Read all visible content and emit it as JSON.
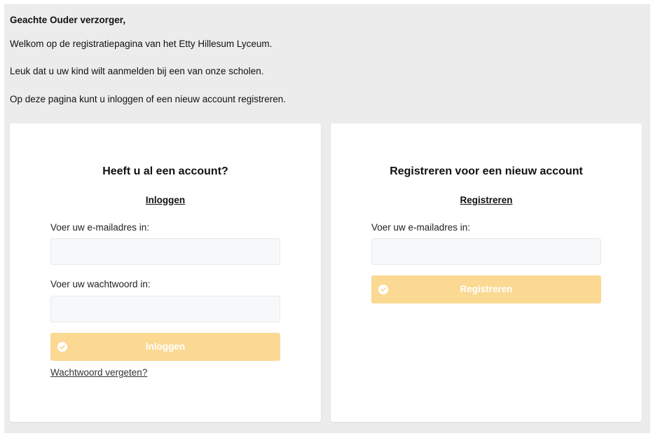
{
  "intro": {
    "greeting": "Geachte Ouder verzorger,",
    "line1": "Welkom op de registratiepagina van het Etty Hillesum Lyceum.",
    "line2": "Leuk dat u uw kind wilt aanmelden bij een van onze scholen.",
    "line3": "Op deze pagina kunt u inloggen of een nieuw account registreren."
  },
  "login": {
    "title": "Heeft u al een account?",
    "link": "Inloggen",
    "email_label": "Voer uw e-mailadres in:",
    "email_value": "",
    "password_label": "Voer uw wachtwoord in:",
    "password_value": "",
    "button_label": "Inloggen",
    "forgot_label": "Wachtwoord vergeten?"
  },
  "register": {
    "title": "Registreren voor een nieuw account",
    "link": "Registreren",
    "email_label": "Voer uw e-mailadres in:",
    "email_value": "",
    "button_label": "Registreren"
  },
  "icons": {
    "button_icon": "check-circle-icon"
  },
  "colors": {
    "page_background": "#ececec",
    "card_background": "#ffffff",
    "button_background": "#fbd993",
    "button_text": "#ffffff",
    "input_background": "#f7f8fa"
  }
}
